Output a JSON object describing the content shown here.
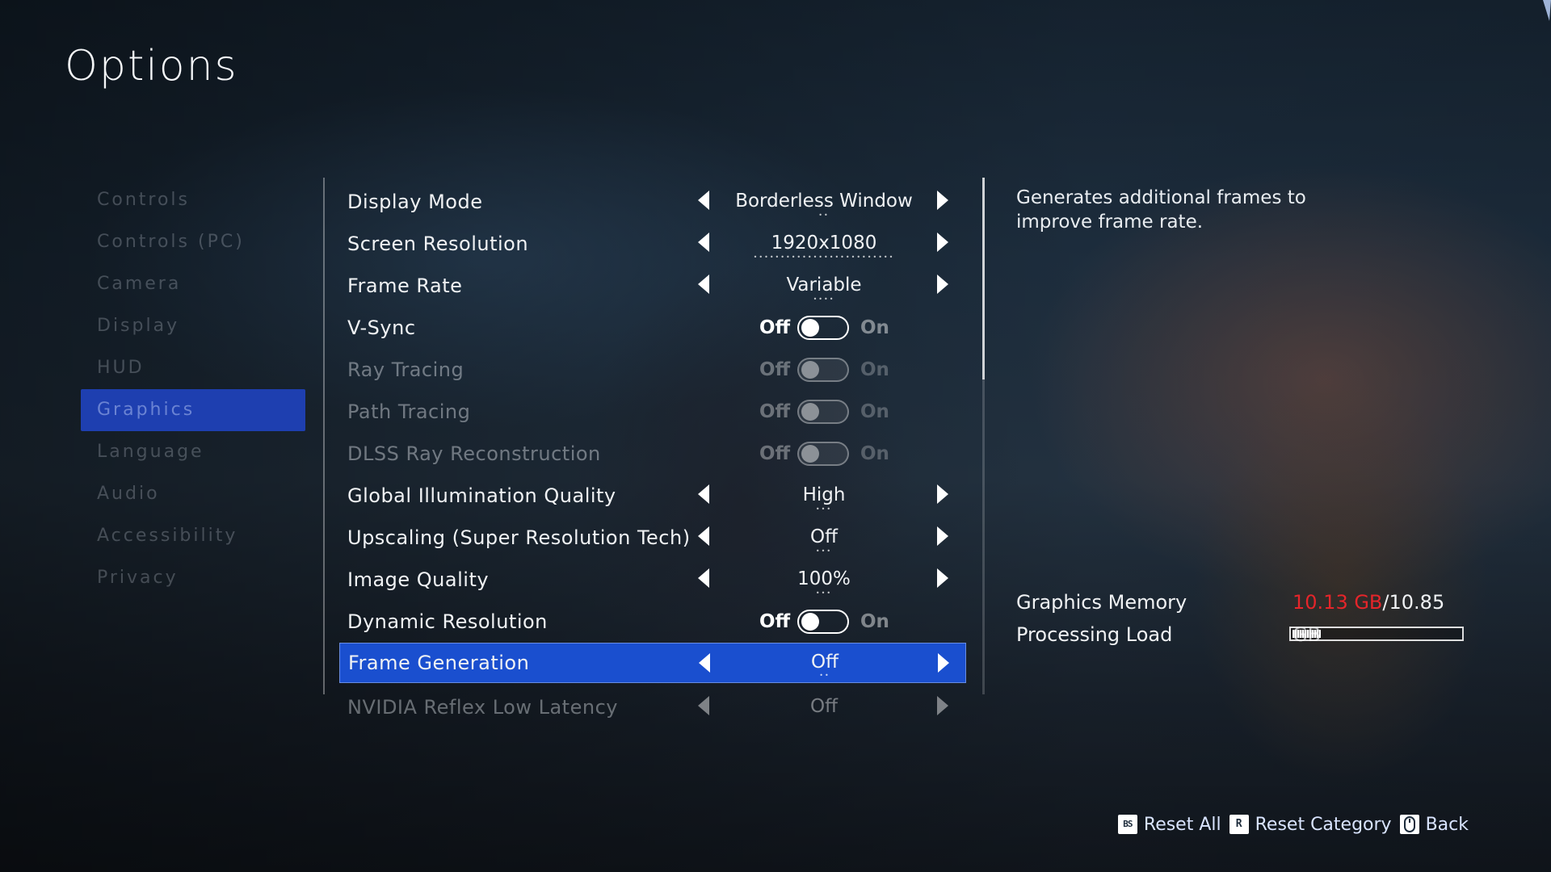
{
  "title": "Options",
  "categories": [
    {
      "label": "Controls"
    },
    {
      "label": "Controls (PC)"
    },
    {
      "label": "Camera"
    },
    {
      "label": "Display"
    },
    {
      "label": "HUD"
    },
    {
      "label": "Graphics"
    },
    {
      "label": "Language"
    },
    {
      "label": "Audio"
    },
    {
      "label": "Accessibility"
    },
    {
      "label": "Privacy"
    }
  ],
  "active_category": "Graphics",
  "settings": [
    {
      "label": "Display Mode",
      "value": "Borderless Window"
    },
    {
      "label": "Screen Resolution",
      "value": "1920x1080"
    },
    {
      "label": "Frame Rate",
      "value": "Variable"
    },
    {
      "label": "V-Sync",
      "off": "Off",
      "on": "On",
      "state": "Off"
    },
    {
      "label": "Ray Tracing",
      "off": "Off",
      "on": "On",
      "state": "Off",
      "enabled": false
    },
    {
      "label": "Path Tracing",
      "off": "Off",
      "on": "On",
      "state": "Off",
      "enabled": false
    },
    {
      "label": "DLSS Ray Reconstruction",
      "off": "Off",
      "on": "On",
      "state": "Off",
      "enabled": false
    },
    {
      "label": "Global Illumination Quality",
      "value": "High"
    },
    {
      "label": "Upscaling (Super Resolution Tech)",
      "value": "Off"
    },
    {
      "label": "Image Quality",
      "value": "100%"
    },
    {
      "label": "Dynamic Resolution",
      "off": "Off",
      "on": "On",
      "state": "Off"
    },
    {
      "label": "Frame Generation",
      "value": "Off",
      "selected": true
    },
    {
      "label": "NVIDIA Reflex Low Latency",
      "value": "Off"
    }
  ],
  "description": "Generates additional frames to improve frame rate.",
  "info": {
    "memory_label": "Graphics Memory",
    "memory_used": "10.13 GB",
    "memory_sep": "/",
    "memory_total": "10.85 GB",
    "load_label": "Processing Load",
    "load_fraction": 0.17
  },
  "legend": [
    {
      "key": "BS",
      "label": "Reset All"
    },
    {
      "key": "R",
      "label": "Reset Category"
    },
    {
      "key": "mouse-icon",
      "label": "Back"
    }
  ],
  "colors": {
    "accent": "#1a4fcf",
    "memory_used": "#e5252a"
  }
}
